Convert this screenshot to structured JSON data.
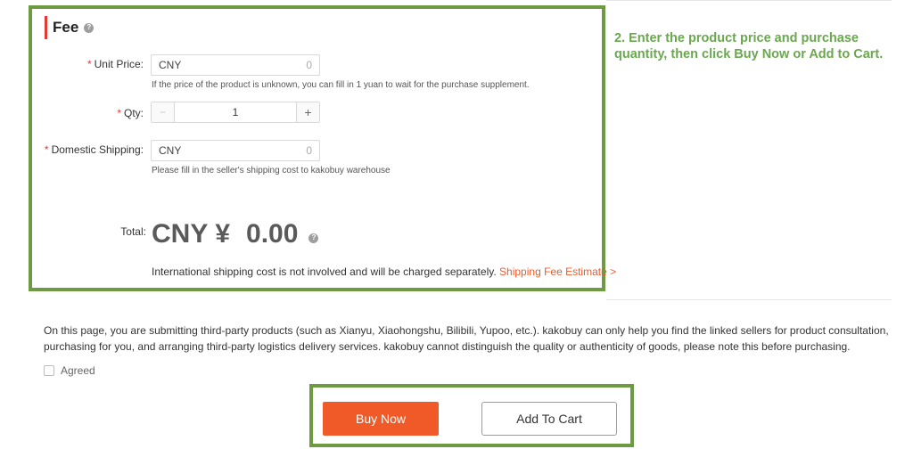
{
  "fee": {
    "title": "Fee",
    "help_icon": "?",
    "unit_price": {
      "label": "Unit Price",
      "currency": "CNY",
      "value": "0",
      "hint": "If the price of the product is unknown, you can fill in 1 yuan to wait for the purchase supplement."
    },
    "qty": {
      "label": "Qty",
      "minus": "−",
      "value": "1",
      "plus": "+"
    },
    "domestic_shipping": {
      "label": "Domestic Shipping",
      "currency": "CNY",
      "value": "0",
      "hint": "Please fill in the seller's shipping cost to kakobuy warehouse"
    },
    "total": {
      "label": "Total",
      "currency": "CNY",
      "symbol": "¥",
      "amount": "0.00"
    },
    "intl_note": "International shipping cost is not involved and will be charged separately.",
    "shipping_estimate_link": "Shipping Fee Estimate >"
  },
  "annotation": "2. Enter the product price and purchase quantity, then click Buy Now or Add to Cart.",
  "disclaimer": "On this page, you are submitting third-party products (such as Xianyu, Xiaohongshu, Bilibili, Yupoo, etc.). kakobuy can only help you find the linked sellers for product consultation, purchasing for you, and arranging third-party logistics delivery services. kakobuy cannot distinguish the quality or authenticity of goods, please note this before purchasing.",
  "agree_label": "Agreed",
  "actions": {
    "buy_now": "Buy Now",
    "add_to_cart": "Add To Cart"
  },
  "colors": {
    "accent": "#f05a28",
    "highlight_border": "#6e9a43",
    "annotation_text": "#6aa84f",
    "required": "#e53935"
  }
}
